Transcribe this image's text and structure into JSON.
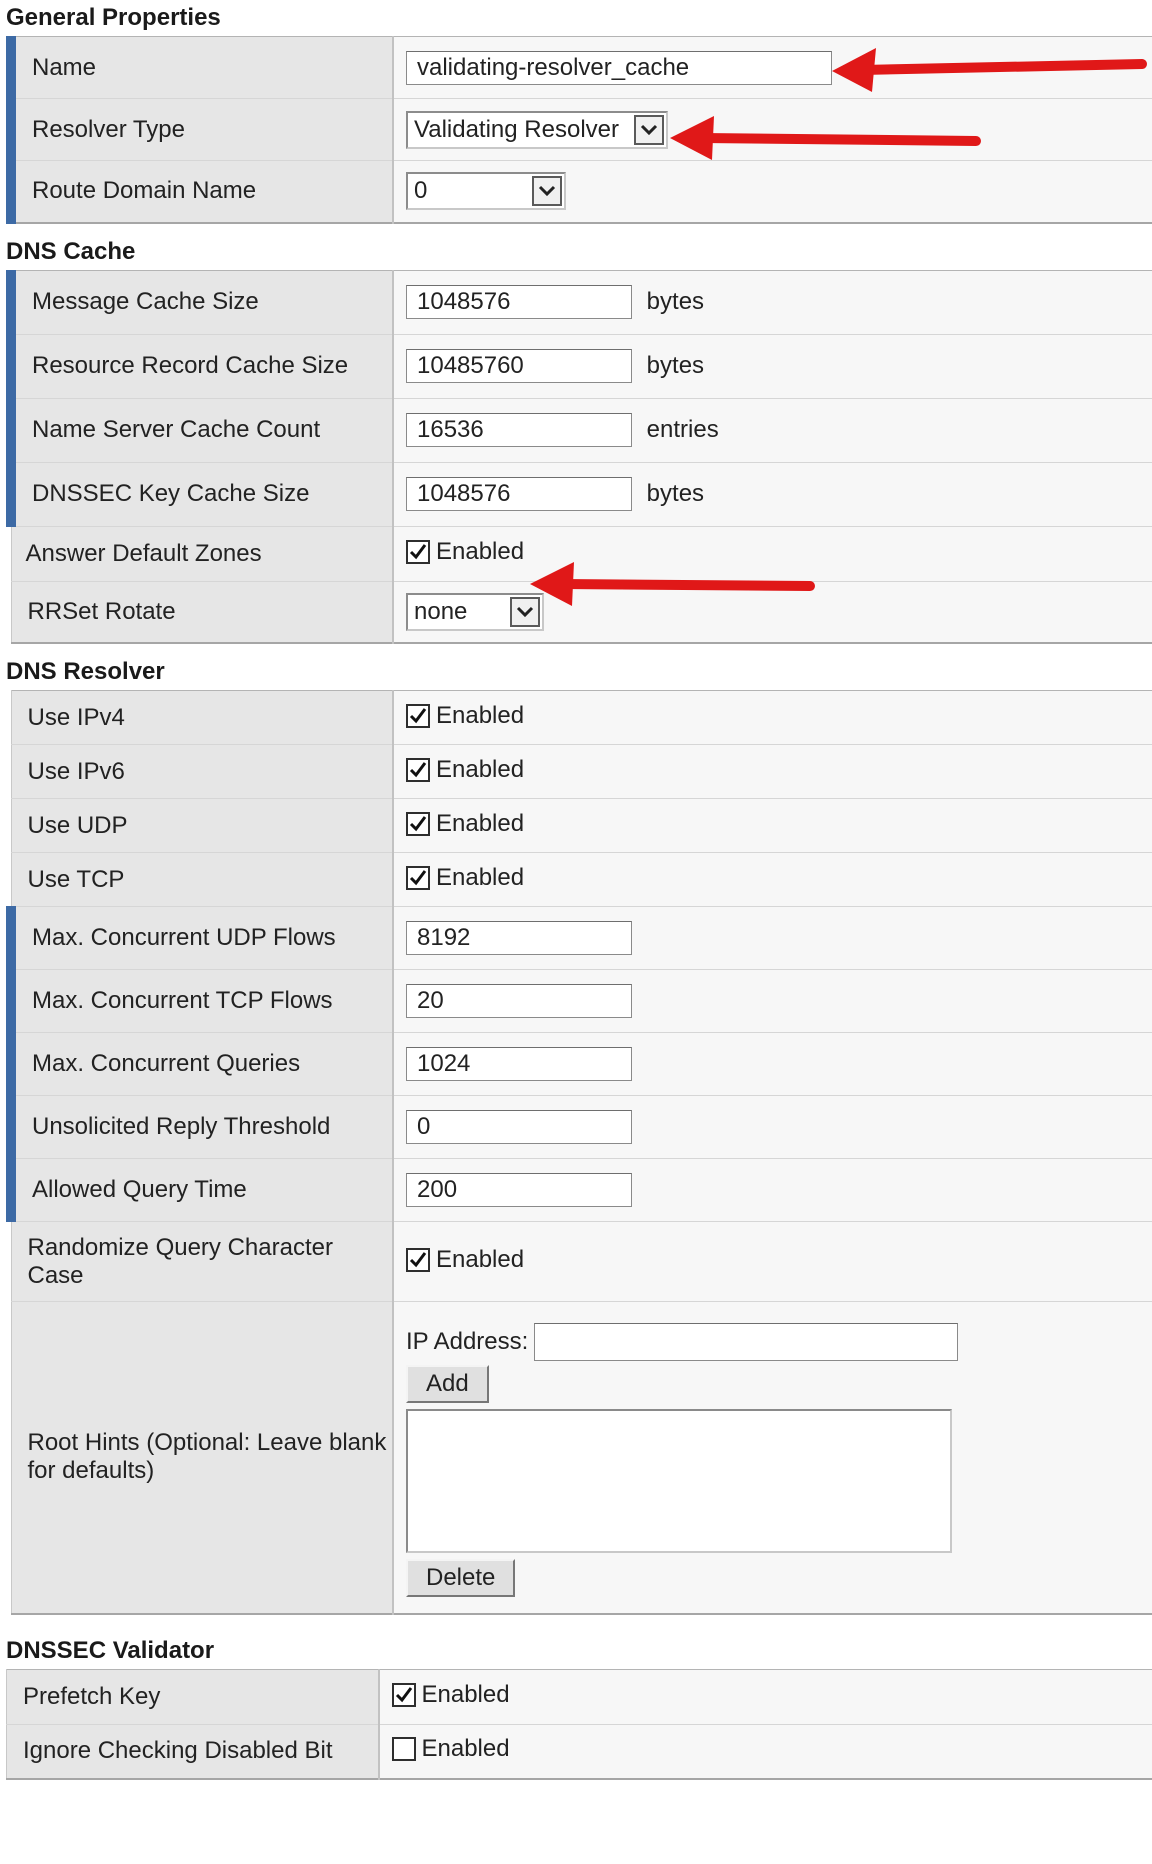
{
  "general": {
    "title": "General Properties",
    "name_label": "Name",
    "name_value": "validating-resolver_cache",
    "resolver_type_label": "Resolver Type",
    "resolver_type_value": "Validating Resolver",
    "route_domain_label": "Route Domain Name",
    "route_domain_value": "0"
  },
  "cache": {
    "title": "DNS Cache",
    "message_cache_label": "Message Cache Size",
    "message_cache_value": "1048576",
    "message_cache_unit": "bytes",
    "rr_cache_label": "Resource Record Cache Size",
    "rr_cache_value": "10485760",
    "rr_cache_unit": "bytes",
    "ns_cache_label": "Name Server Cache Count",
    "ns_cache_value": "16536",
    "ns_cache_unit": "entries",
    "dnssec_cache_label": "DNSSEC Key Cache Size",
    "dnssec_cache_value": "1048576",
    "dnssec_cache_unit": "bytes",
    "answer_default_label": "Answer Default Zones",
    "answer_default_text": "Enabled",
    "rrset_label": "RRSet Rotate",
    "rrset_value": "none"
  },
  "resolver": {
    "title": "DNS Resolver",
    "ipv4_label": "Use IPv4",
    "ipv4_text": "Enabled",
    "ipv6_label": "Use IPv6",
    "ipv6_text": "Enabled",
    "udp_label": "Use UDP",
    "udp_text": "Enabled",
    "tcp_label": "Use TCP",
    "tcp_text": "Enabled",
    "udp_flows_label": "Max. Concurrent UDP Flows",
    "udp_flows_value": "8192",
    "tcp_flows_label": "Max. Concurrent TCP Flows",
    "tcp_flows_value": "20",
    "queries_label": "Max. Concurrent Queries",
    "queries_value": "1024",
    "unsolicited_label": "Unsolicited Reply Threshold",
    "unsolicited_value": "0",
    "query_time_label": "Allowed Query Time",
    "query_time_value": "200",
    "randomize_label": "Randomize Query Character Case",
    "randomize_text": "Enabled",
    "root_hints_label": "Root Hints (Optional: Leave blank for defaults)",
    "ip_address_label": "IP Address:",
    "ip_address_value": "",
    "add_label": "Add",
    "delete_label": "Delete"
  },
  "validator": {
    "title": "DNSSEC Validator",
    "prefetch_label": "Prefetch Key",
    "prefetch_text": "Enabled",
    "ignore_cd_label": "Ignore Checking Disabled Bit",
    "ignore_cd_text": "Enabled"
  },
  "colors": {
    "required_bar": "#3d6aa5",
    "annotation_arrow": "#e01818"
  },
  "checkboxes": {
    "answer_default": true,
    "ipv4": true,
    "ipv6": true,
    "udp": true,
    "tcp": true,
    "randomize": true,
    "prefetch": true,
    "ignore_cd": false
  }
}
